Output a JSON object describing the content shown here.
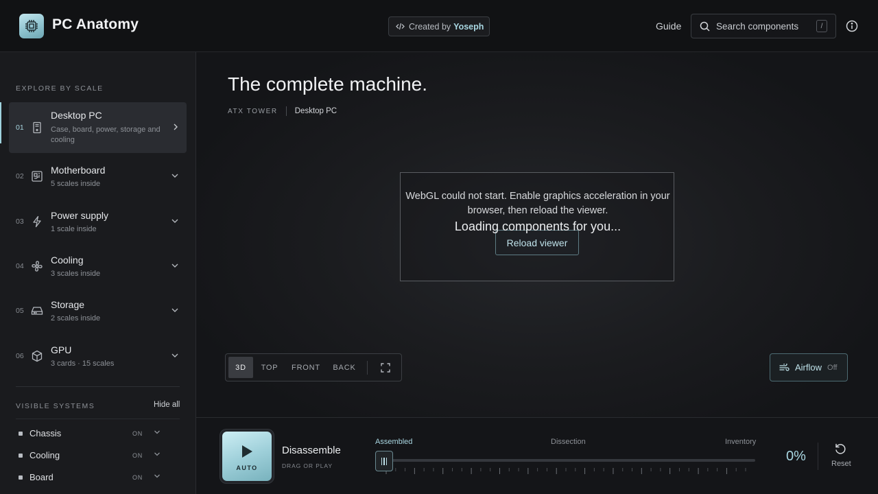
{
  "app": {
    "title": "PC Anatomy",
    "logo_icon": "cpu-chip-icon"
  },
  "header": {
    "credit_prefix": "Created by",
    "credit_name": "Yoseph",
    "guide_label": "Guide",
    "search_placeholder": "Search components",
    "search_shortcut": "/",
    "info_icon": "info-icon"
  },
  "sidebar": {
    "explore_title": "EXPLORE BY SCALE",
    "items": [
      {
        "num": "01",
        "label": "Desktop PC",
        "sub": "Case, board, power, storage and cooling",
        "icon": "tower-case-icon",
        "active": true
      },
      {
        "num": "02",
        "label": "Motherboard",
        "sub": "5 scales inside",
        "icon": "circuit-board-icon"
      },
      {
        "num": "03",
        "label": "Power supply",
        "sub": "1 scale inside",
        "icon": "lightning-bolt-icon"
      },
      {
        "num": "04",
        "label": "Cooling",
        "sub": "3 scales inside",
        "icon": "fan-icon"
      },
      {
        "num": "05",
        "label": "Storage",
        "sub": "2 scales inside",
        "icon": "hard-drive-icon"
      },
      {
        "num": "06",
        "label": "GPU",
        "sub": "3 cards · 15 scales",
        "icon": "cube-icon"
      }
    ],
    "systems_title": "VISIBLE SYSTEMS",
    "hide_all_label": "Hide all",
    "systems": [
      {
        "label": "Chassis",
        "state": "ON"
      },
      {
        "label": "Cooling",
        "state": "ON"
      },
      {
        "label": "Board",
        "state": "ON"
      }
    ]
  },
  "viewer": {
    "title": "The complete machine.",
    "tag": "ATX TOWER",
    "crumb": "Desktop PC",
    "error_message": "WebGL could not start. Enable graphics acceleration in your browser, then reload the viewer.",
    "loading_message": "Loading components for you...",
    "reload_label": "Reload viewer",
    "view_modes": [
      "3D",
      "TOP",
      "FRONT",
      "BACK"
    ],
    "active_view": "3D",
    "airflow_label": "Airflow",
    "airflow_state": "Off"
  },
  "bottom": {
    "auto_label": "AUTO",
    "title": "Disassemble",
    "subtitle": "DRAG OR PLAY",
    "stages": [
      "Assembled",
      "Dissection",
      "Inventory"
    ],
    "progress_percent": 0,
    "percent_text": "0%",
    "reset_label": "Reset"
  },
  "colors": {
    "accent": "#a9d7e2",
    "background": "#121316",
    "sidebar": "#1a1b1e"
  }
}
